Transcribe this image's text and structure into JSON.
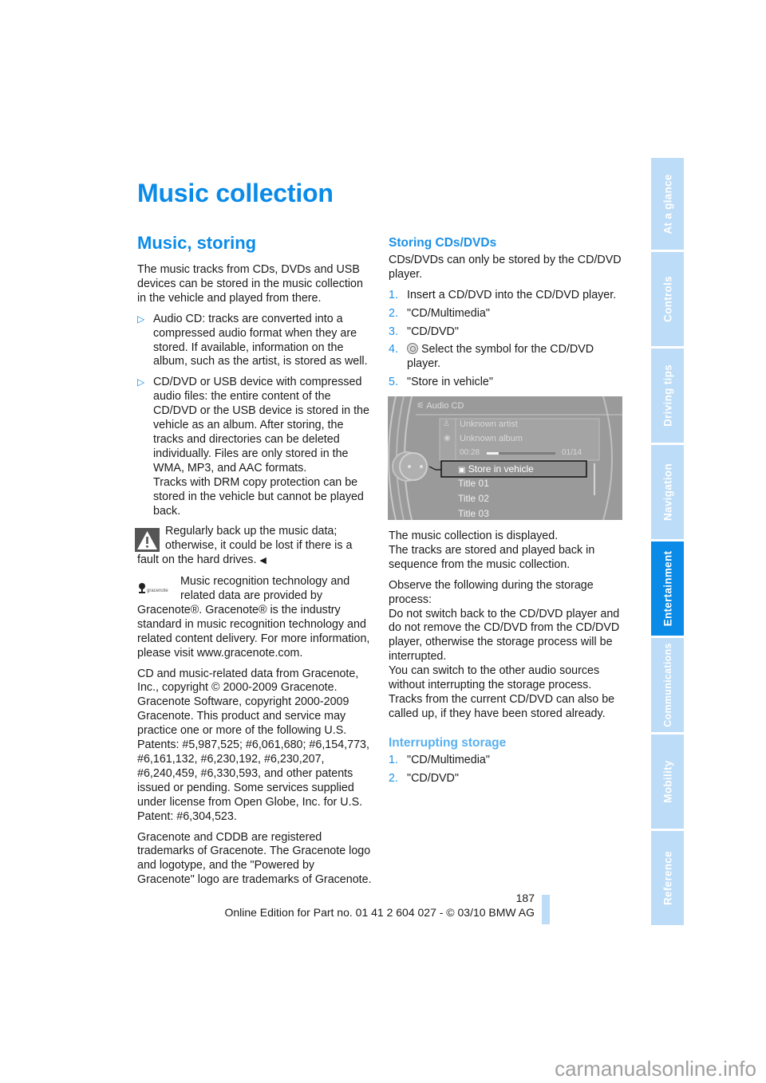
{
  "page": {
    "title": "Music collection",
    "section_title": "Music, storing",
    "page_number": "187",
    "footer": "Online Edition for Part no. 01 41 2 604 027 - © 03/10 BMW AG",
    "watermark": "carmanualsonline.info"
  },
  "colors": {
    "heading_blue": "#0a8be8",
    "subheading_light_blue": "#56b0f0",
    "tab_inactive": "#bcdcf7",
    "tab_active": "#0a8be8"
  },
  "side_tabs": [
    {
      "label": "At a glance",
      "active": false
    },
    {
      "label": "Controls",
      "active": false
    },
    {
      "label": "Driving tips",
      "active": false
    },
    {
      "label": "Navigation",
      "active": false
    },
    {
      "label": "Entertainment",
      "active": true
    },
    {
      "label": "Communications",
      "active": false
    },
    {
      "label": "Mobility",
      "active": false
    },
    {
      "label": "Reference",
      "active": false
    }
  ],
  "left": {
    "intro": "The music tracks from CDs, DVDs and USB devices can be stored in the music collection in the vehicle and played from there.",
    "bullets": [
      {
        "icon": "triangle-bullet-icon",
        "text": "Audio CD: tracks are converted into a compressed audio format when they are stored. If available, information on the album, such as the artist, is stored as well."
      },
      {
        "icon": "triangle-bullet-icon",
        "text": "CD/DVD or USB device with compressed audio files: the entire content of the CD/DVD or the USB device is stored in the vehicle as an album. After storing, the tracks and directories can be deleted individually. Files are only stored in the WMA, MP3, and AAC formats.",
        "text2": "Tracks with DRM copy protection can be stored in the vehicle but cannot be played back."
      }
    ],
    "warning": {
      "icon": "warning-icon",
      "text": "Regularly back up the music data; otherwise, it could be lost if there is a fault on the hard drives.",
      "end_mark": "◀"
    },
    "gracenote": {
      "icon": "gracenote-logo-icon",
      "logo_text": "gracenote",
      "text": "Music recognition technology and related data are provided by Gracenote®. Gracenote® is the industry standard in music recognition technology and related content delivery. For more information, please visit www.gracenote.com."
    },
    "copyright": "CD and music-related data from Gracenote, Inc., copyright © 2000-2009 Gracenote. Gracenote Software, copyright 2000-2009 Gracenote. This product and service may practice one or more of the following U.S. Patents: #5,987,525; #6,061,680; #6,154,773, #6,161,132, #6,230,192, #6,230,207, #6,240,459, #6,330,593, and other patents issued or pending. Some services supplied under license from Open Globe, Inc. for U.S. Patent: #6,304,523.",
    "trademarks": "Gracenote and CDDB are registered trademarks of Gracenote. The Gracenote logo and logotype, and the \"Powered by Gracenote\" logo are trademarks of Gracenote."
  },
  "right": {
    "storing_heading": "Storing CDs/DVDs",
    "storing_intro": "CDs/DVDs can only be stored by the CD/DVD player.",
    "storing_steps": [
      {
        "num": "1.",
        "text": "Insert a CD/DVD into the CD/DVD player."
      },
      {
        "num": "2.",
        "text": "\"CD/Multimedia\""
      },
      {
        "num": "3.",
        "text": "\"CD/DVD\""
      },
      {
        "num": "4.",
        "icon": "cd-dvd-player-icon",
        "text": "Select the symbol for the CD/DVD player."
      },
      {
        "num": "5.",
        "text": "\"Store in vehicle\""
      }
    ],
    "screen": {
      "header": "Audio CD",
      "artist": "Unknown artist",
      "album": "Unknown album",
      "elapsed": "00:28",
      "track_counter": "01/14",
      "progress_fraction": 0.18,
      "selected_item": "Store in vehicle",
      "tracks": [
        "Title 01",
        "Title 02",
        "Title 03"
      ]
    },
    "after_screen_1": "The music collection is displayed.",
    "after_screen_2": "The tracks are stored and played back in sequence from the music collection.",
    "observe": "Observe the following during the storage process:",
    "observe_2": "Do not switch back to the CD/DVD player and do not remove the CD/DVD from the CD/DVD player, otherwise the storage process will be interrupted.",
    "observe_3": "You can switch to the other audio sources without interrupting the storage process. Tracks from the current CD/DVD can also be called up, if they have been stored already.",
    "interrupt_heading": "Interrupting storage",
    "interrupt_steps": [
      {
        "num": "1.",
        "text": "\"CD/Multimedia\""
      },
      {
        "num": "2.",
        "text": "\"CD/DVD\""
      }
    ]
  }
}
